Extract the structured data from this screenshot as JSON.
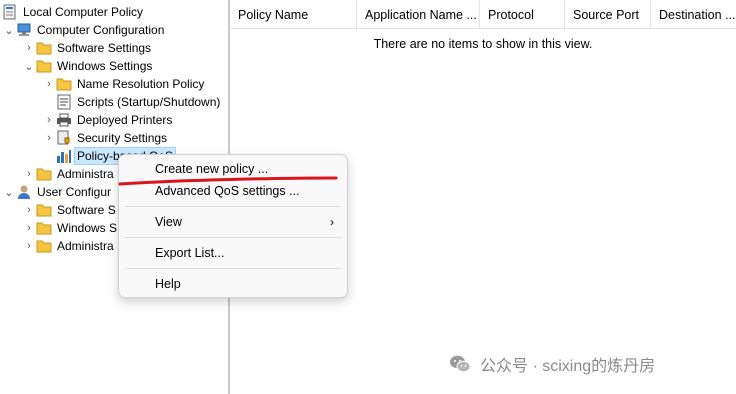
{
  "tree": {
    "nodes": [
      {
        "label": "Local Computer Policy",
        "toggle": "",
        "icon": "policy-book-icon"
      },
      {
        "label": "Computer Configuration",
        "toggle": "expanded",
        "icon": "computer-icon"
      },
      {
        "label": "Software Settings",
        "toggle": "collapsed",
        "icon": "folder-icon"
      },
      {
        "label": "Windows Settings",
        "toggle": "expanded",
        "icon": "folder-icon"
      },
      {
        "label": "Name Resolution Policy",
        "toggle": "collapsed",
        "icon": "folder-icon"
      },
      {
        "label": "Scripts (Startup/Shutdown)",
        "toggle": "",
        "icon": "scripts-icon"
      },
      {
        "label": "Deployed Printers",
        "toggle": "collapsed",
        "icon": "printer-icon"
      },
      {
        "label": "Security Settings",
        "toggle": "collapsed",
        "icon": "security-icon"
      },
      {
        "label": "Policy-based QoS",
        "toggle": "",
        "icon": "qos-chart-icon",
        "selected": true
      },
      {
        "label": "Administra",
        "toggle": "collapsed",
        "icon": "folder-icon"
      },
      {
        "label": "User Configur",
        "toggle": "expanded",
        "icon": "user-icon"
      },
      {
        "label": "Software S",
        "toggle": "collapsed",
        "icon": "folder-icon"
      },
      {
        "label": "Windows S",
        "toggle": "collapsed",
        "icon": "folder-icon"
      },
      {
        "label": "Administra",
        "toggle": "collapsed",
        "icon": "folder-icon"
      }
    ]
  },
  "list": {
    "columns": [
      "Policy Name",
      "Application Name ...",
      "Protocol",
      "Source Port",
      "Destination ..."
    ],
    "empty_message": "There are no items to show in this view."
  },
  "context_menu": {
    "items": {
      "create": "Create new policy ...",
      "advanced": "Advanced QoS settings ...",
      "view": "View",
      "export": "Export List...",
      "help": "Help"
    },
    "submenu_arrow": "›",
    "annotation_color": "#d9141b"
  },
  "watermark": {
    "text": "公众号 · scixing的炼丹房",
    "icon": "wechat-logo-icon"
  },
  "colors": {
    "selection_bg": "#cce8ff",
    "folder": "#f5c542"
  }
}
